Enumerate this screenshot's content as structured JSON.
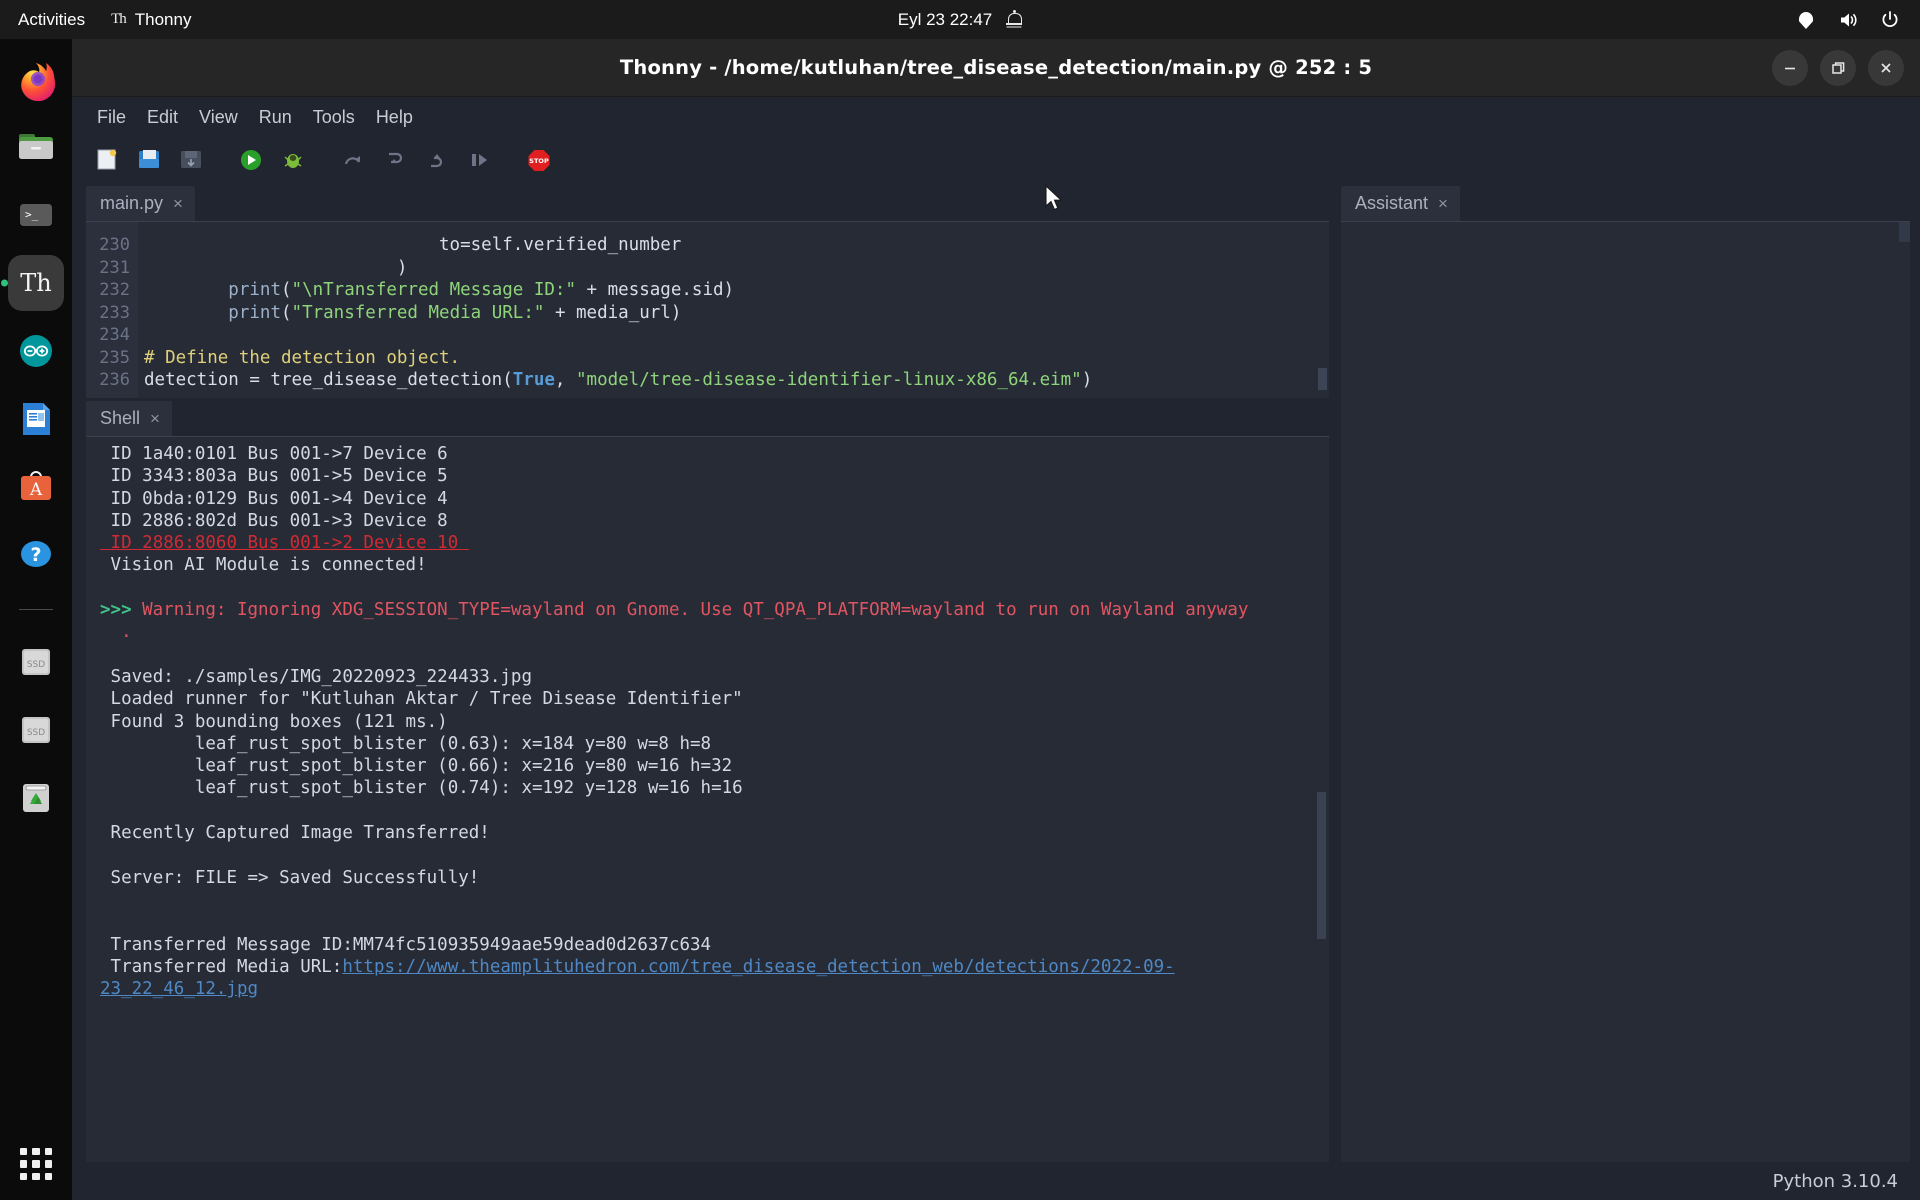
{
  "topbar": {
    "activities": "Activities",
    "app_name": "Thonny",
    "app_icon_text": "Th",
    "clock": "Eyl 23  22:47",
    "icons": [
      "bell-icon",
      "network-icon",
      "volume-icon",
      "power-icon"
    ]
  },
  "dock": {
    "items": [
      {
        "name": "firefox",
        "label": "Firefox",
        "active": false
      },
      {
        "name": "files",
        "label": "Files",
        "active": false
      },
      {
        "name": "terminal",
        "label": "Terminal",
        "active": false
      },
      {
        "name": "thonny",
        "label": "Thonny",
        "active": true,
        "icon_text": "Th"
      },
      {
        "name": "arduino-ide",
        "label": "Arduino IDE",
        "active": false
      },
      {
        "name": "libreoffice",
        "label": "LibreOffice",
        "active": false
      },
      {
        "name": "ubuntu-software",
        "label": "Ubuntu Software",
        "active": false
      },
      {
        "name": "help",
        "label": "Help",
        "active": false
      }
    ],
    "drives": [
      {
        "name": "ssd-1",
        "label": "SSD"
      },
      {
        "name": "ssd-2",
        "label": "SSD"
      },
      {
        "name": "trash",
        "label": "Trash"
      }
    ],
    "show_apps_label": "Show Applications"
  },
  "window": {
    "title": "Thonny  -  /home/kutluhan/tree_disease_detection/main.py  @  252 : 5",
    "controls": {
      "minimize": "minimize",
      "maximize": "maximize",
      "close": "close"
    }
  },
  "menubar": {
    "items": [
      "File",
      "Edit",
      "View",
      "Run",
      "Tools",
      "Help"
    ]
  },
  "toolbar": {
    "buttons": [
      {
        "name": "new-file",
        "label": "New"
      },
      {
        "name": "open-file",
        "label": "Load"
      },
      {
        "name": "save-file",
        "label": "Save"
      },
      {
        "name": "run-script",
        "label": "Run current script"
      },
      {
        "name": "debug-script",
        "label": "Debug current script"
      },
      {
        "name": "step-over",
        "label": "Step over"
      },
      {
        "name": "step-into",
        "label": "Step into"
      },
      {
        "name": "step-out",
        "label": "Step out"
      },
      {
        "name": "resume",
        "label": "Resume"
      },
      {
        "name": "stop",
        "label": "Stop/Restart backend"
      }
    ]
  },
  "editor": {
    "tab": {
      "label": "main.py",
      "close": "×"
    },
    "first_line_number": 230,
    "lines": [
      {
        "num": "230",
        "indent": 28,
        "tokens": [
          {
            "t": "to=self.verified_number",
            "c": "plain"
          }
        ]
      },
      {
        "num": "231",
        "indent": 24,
        "tokens": [
          {
            "t": ")",
            "c": "plain"
          }
        ]
      },
      {
        "num": "232",
        "indent": 8,
        "tokens": [
          {
            "t": "print",
            "c": "fn"
          },
          {
            "t": "(",
            "c": "plain"
          },
          {
            "t": "\"\\nTransferred Message ID:\"",
            "c": "str"
          },
          {
            "t": " + message.sid)",
            "c": "plain"
          }
        ]
      },
      {
        "num": "233",
        "indent": 8,
        "tokens": [
          {
            "t": "print",
            "c": "fn"
          },
          {
            "t": "(",
            "c": "plain"
          },
          {
            "t": "\"Transferred Media URL:\"",
            "c": "str"
          },
          {
            "t": " + media_url)",
            "c": "plain"
          }
        ]
      },
      {
        "num": "234",
        "indent": 0,
        "tokens": []
      },
      {
        "num": "235",
        "indent": 0,
        "tokens": [
          {
            "t": "# Define the detection object.",
            "c": "com"
          }
        ]
      },
      {
        "num": "236",
        "indent": 0,
        "tokens": [
          {
            "t": "detection = tree_disease_detection(",
            "c": "plain"
          },
          {
            "t": "True",
            "c": "bool"
          },
          {
            "t": ", ",
            "c": "plain"
          },
          {
            "t": "\"model/tree-disease-identifier-linux-x86_64.eim\"",
            "c": "str"
          },
          {
            "t": ")",
            "c": "plain"
          }
        ]
      }
    ]
  },
  "shell": {
    "tab": {
      "label": "Shell",
      "close": "×"
    },
    "lines": [
      {
        "style": "normal",
        "text": " ID 1a40:0101 Bus 001->7 Device 6"
      },
      {
        "style": "normal",
        "text": " ID 3343:803a Bus 001->5 Device 5"
      },
      {
        "style": "normal",
        "text": " ID 0bda:0129 Bus 001->4 Device 4"
      },
      {
        "style": "normal",
        "text": " ID 2886:802d Bus 001->3 Device 8"
      },
      {
        "style": "error-underline",
        "text": " ID 2886:8060 Bus 001->2 Device 10 "
      },
      {
        "style": "normal",
        "text": " Vision AI Module is connected!"
      },
      {
        "style": "blank",
        "text": ""
      },
      {
        "style": "warning-prompt",
        "prompt": ">>>",
        "text": " Warning: Ignoring XDG_SESSION_TYPE=wayland on Gnome. Use QT_QPA_PLATFORM=wayland to run on Wayland anyway"
      },
      {
        "style": "warning-cont",
        "text": "  ."
      },
      {
        "style": "blank",
        "text": ""
      },
      {
        "style": "normal",
        "text": " Saved: ./samples/IMG_20220923_224433.jpg"
      },
      {
        "style": "normal",
        "text": " Loaded runner for \"Kutluhan Aktar / Tree Disease Identifier\""
      },
      {
        "style": "normal",
        "text": " Found 3 bounding boxes (121 ms.)"
      },
      {
        "style": "normal",
        "text": "         leaf_rust_spot_blister (0.63): x=184 y=80 w=8 h=8"
      },
      {
        "style": "normal",
        "text": "         leaf_rust_spot_blister (0.66): x=216 y=80 w=16 h=32"
      },
      {
        "style": "normal",
        "text": "         leaf_rust_spot_blister (0.74): x=192 y=128 w=16 h=16"
      },
      {
        "style": "blank",
        "text": ""
      },
      {
        "style": "normal",
        "text": " Recently Captured Image Transferred!"
      },
      {
        "style": "blank",
        "text": ""
      },
      {
        "style": "normal",
        "text": " Server: FILE => Saved Successfully!"
      },
      {
        "style": "blank",
        "text": ""
      },
      {
        "style": "blank",
        "text": ""
      },
      {
        "style": "normal",
        "text": " Transferred Message ID:MM74fc510935949aae59dead0d2637c634"
      },
      {
        "style": "link-line",
        "prefix": " Transferred Media URL:",
        "link": "https://www.theamplituhedron.com/tree_disease_detection_web/detections/2022-09-23_22_46_12.jpg"
      }
    ]
  },
  "assistant": {
    "tab": {
      "label": "Assistant",
      "close": "×"
    },
    "content": ""
  },
  "statusbar": {
    "interpreter": "Python 3.10.4"
  },
  "colors": {
    "window_bg": "#21252f",
    "panel_bg": "#262b36",
    "tab_active": "#2b303c",
    "string": "#8fd47a",
    "comment": "#e0d07a",
    "keyword": "#c586f0",
    "error": "#e05561",
    "prompt_green": "#41c58a",
    "link": "#4f88c4",
    "accent_green": "#2ec27e"
  }
}
